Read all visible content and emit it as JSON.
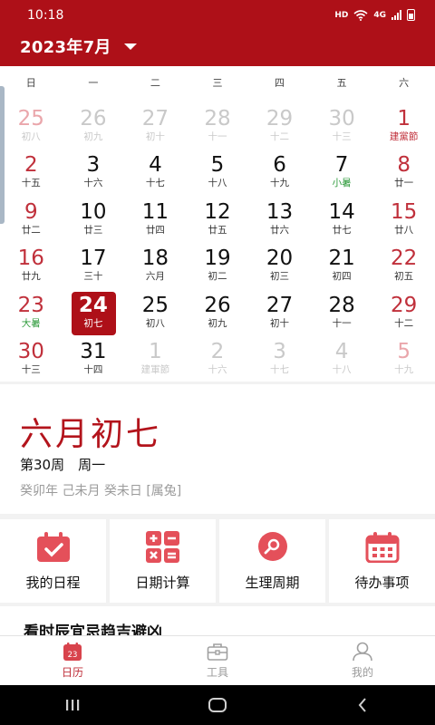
{
  "status": {
    "time": "10:18",
    "hd": "HD",
    "net": "4G"
  },
  "header": {
    "month_label": "2023年7月"
  },
  "weekdays": [
    "日",
    "一",
    "二",
    "三",
    "四",
    "五",
    "六"
  ],
  "calendar_rows": [
    [
      {
        "d": "25",
        "l": "初八",
        "other": true
      },
      {
        "d": "26",
        "l": "初九",
        "other": true
      },
      {
        "d": "27",
        "l": "初十",
        "other": true
      },
      {
        "d": "28",
        "l": "十一",
        "other": true
      },
      {
        "d": "29",
        "l": "十二",
        "other": true
      },
      {
        "d": "30",
        "l": "十三",
        "other": true
      },
      {
        "d": "1",
        "l": "建黨節",
        "fest": true
      }
    ],
    [
      {
        "d": "2",
        "l": "十五"
      },
      {
        "d": "3",
        "l": "十六"
      },
      {
        "d": "4",
        "l": "十七"
      },
      {
        "d": "5",
        "l": "十八"
      },
      {
        "d": "6",
        "l": "十九"
      },
      {
        "d": "7",
        "l": "小暑",
        "term": true
      },
      {
        "d": "8",
        "l": "廿一"
      }
    ],
    [
      {
        "d": "9",
        "l": "廿二"
      },
      {
        "d": "10",
        "l": "廿三"
      },
      {
        "d": "11",
        "l": "廿四"
      },
      {
        "d": "12",
        "l": "廿五"
      },
      {
        "d": "13",
        "l": "廿六"
      },
      {
        "d": "14",
        "l": "廿七"
      },
      {
        "d": "15",
        "l": "廿八"
      }
    ],
    [
      {
        "d": "16",
        "l": "廿九"
      },
      {
        "d": "17",
        "l": "三十"
      },
      {
        "d": "18",
        "l": "六月"
      },
      {
        "d": "19",
        "l": "初二"
      },
      {
        "d": "20",
        "l": "初三"
      },
      {
        "d": "21",
        "l": "初四"
      },
      {
        "d": "22",
        "l": "初五"
      }
    ],
    [
      {
        "d": "23",
        "l": "大暑",
        "term": true
      },
      {
        "d": "24",
        "l": "初七",
        "selected": true
      },
      {
        "d": "25",
        "l": "初八"
      },
      {
        "d": "26",
        "l": "初九"
      },
      {
        "d": "27",
        "l": "初十"
      },
      {
        "d": "28",
        "l": "十一"
      },
      {
        "d": "29",
        "l": "十二"
      }
    ],
    [
      {
        "d": "30",
        "l": "十三"
      },
      {
        "d": "31",
        "l": "十四"
      },
      {
        "d": "1",
        "l": "建軍節",
        "other": true,
        "fest": true
      },
      {
        "d": "2",
        "l": "十六",
        "other": true
      },
      {
        "d": "3",
        "l": "十七",
        "other": true
      },
      {
        "d": "4",
        "l": "十八",
        "other": true
      },
      {
        "d": "5",
        "l": "十九",
        "other": true
      }
    ]
  ],
  "info": {
    "lunar_date": "六月初七",
    "week_line": "第30周　周一",
    "ganzhi_line": "癸卯年 己未月 癸未日 [属兔]"
  },
  "tools": [
    {
      "label": "我的日程",
      "icon": "calendar-check-icon"
    },
    {
      "label": "日期计算",
      "icon": "calculator-icon"
    },
    {
      "label": "生理周期",
      "icon": "cycle-search-icon"
    },
    {
      "label": "待办事项",
      "icon": "calendar-grid-icon"
    }
  ],
  "peek_text": "看时辰宜忌趋吉避凶",
  "bottom_nav": [
    {
      "label": "日历",
      "icon": "calendar-icon",
      "badge": "23",
      "active": true
    },
    {
      "label": "工具",
      "icon": "toolbox-icon"
    },
    {
      "label": "我的",
      "icon": "person-icon"
    }
  ],
  "colors": {
    "brand": "#ae1018",
    "weekend": "#c0303b",
    "solar_term": "#2c9a3a"
  }
}
